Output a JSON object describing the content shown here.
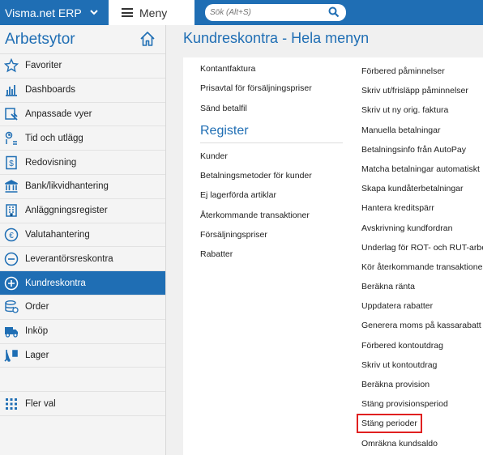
{
  "topbar": {
    "brand": "Visma.net ERP",
    "menu_label": "Meny",
    "search_placeholder": "Sök (Alt+S)"
  },
  "sidebar": {
    "title": "Arbetsytor",
    "items": [
      {
        "label": "Favoriter",
        "icon": "star-icon"
      },
      {
        "label": "Dashboards",
        "icon": "bar-chart-icon"
      },
      {
        "label": "Anpassade vyer",
        "icon": "custom-view-icon"
      },
      {
        "label": "Tid och utlägg",
        "icon": "time-expense-icon"
      },
      {
        "label": "Redovisning",
        "icon": "dollar-document-icon"
      },
      {
        "label": "Bank/likvidhantering",
        "icon": "bank-icon"
      },
      {
        "label": "Anläggningsregister",
        "icon": "building-icon"
      },
      {
        "label": "Valutahantering",
        "icon": "euro-icon"
      },
      {
        "label": "Leverantörsreskontra",
        "icon": "minus-circle-icon"
      },
      {
        "label": "Kundreskontra",
        "icon": "plus-circle-icon"
      },
      {
        "label": "Order",
        "icon": "order-icon"
      },
      {
        "label": "Inköp",
        "icon": "truck-icon"
      },
      {
        "label": "Lager",
        "icon": "forklift-icon"
      }
    ],
    "more": {
      "label": "Fler val",
      "icon": "grid-icon"
    }
  },
  "main": {
    "title": "Kundreskontra - Hela menyn",
    "col1_top": [
      "Kontantfaktura",
      "Prisavtal för försäljningspriser",
      "Sänd betalfil"
    ],
    "register_heading": "Register",
    "register_links": [
      "Kunder",
      "Betalningsmetoder för kunder",
      "Ej lagerförda artiklar",
      "Återkommande transaktioner",
      "Försäljningspriser",
      "Rabatter"
    ],
    "col2_links": [
      "Förbered påminnelser",
      "Skriv ut/frisläpp påminnelser",
      "Skriv ut ny orig. faktura",
      "Manuella betalningar",
      "Betalningsinfo från AutoPay",
      "Matcha betalningar automatiskt",
      "Skapa kundåterbetalningar",
      "Hantera kreditspärr",
      "Avskrivning kundfordran",
      "Underlag för ROT- och RUT-arbete",
      "Kör återkommande transaktioner",
      "Beräkna ränta",
      "Uppdatera rabatter",
      "Generera moms på kassarabatt",
      "Förbered kontoutdrag",
      "Skriv ut kontoutdrag",
      "Beräkna provision",
      "Stäng provisionsperiod",
      "Stäng perioder",
      "Omräkna kundsaldo"
    ],
    "highlighted": "Stäng perioder"
  },
  "colors": {
    "accent": "#1f6eb4",
    "highlight_border": "#e02020"
  }
}
